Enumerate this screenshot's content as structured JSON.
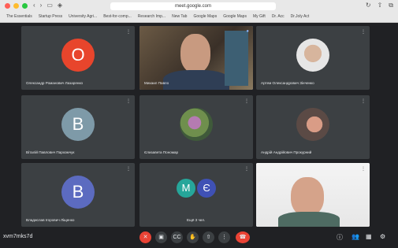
{
  "browser": {
    "url": "meet.google.com",
    "bookmarks": [
      "The Essentials",
      "Startup Press",
      "University Agri...",
      "Best-for-comp...",
      "Research Imp...",
      "New Tab",
      "Google Maps",
      "Google Maps",
      "My Gift",
      "Dr. Acc",
      "Dr.Joly Act"
    ]
  },
  "tiles": [
    {
      "name": "Олександр Романович Лазаренко",
      "initial": "O",
      "color": "#e8452c",
      "type": "initial"
    },
    {
      "name": "Михаил Павло",
      "type": "video",
      "active": true
    },
    {
      "name": "Артем Олександрович Зінченко",
      "type": "photo"
    },
    {
      "name": "Віталій Павлович Пархомчук",
      "initial": "B",
      "color": "#7e9aa8",
      "type": "initial"
    },
    {
      "name": "Єлизавета Пономар",
      "type": "photo2"
    },
    {
      "name": "Андрій Андрійович Прокурний",
      "type": "photo3"
    },
    {
      "name": "Владислав Ігорович Ліщенко",
      "initial": "B",
      "color": "#5c6bc0",
      "type": "initial"
    },
    {
      "name": "Ещё 3 чел.",
      "type": "group",
      "initials": [
        "M",
        "Є"
      ],
      "colors": [
        "#26a69a",
        "#3f51b5"
      ]
    },
    {
      "name": "",
      "type": "video2"
    }
  ],
  "bottom": {
    "meeting_code": "xvm7mks7d",
    "controls": [
      "mic-off",
      "camera",
      "captions",
      "raise-hand",
      "present",
      "more",
      "end-call"
    ]
  }
}
